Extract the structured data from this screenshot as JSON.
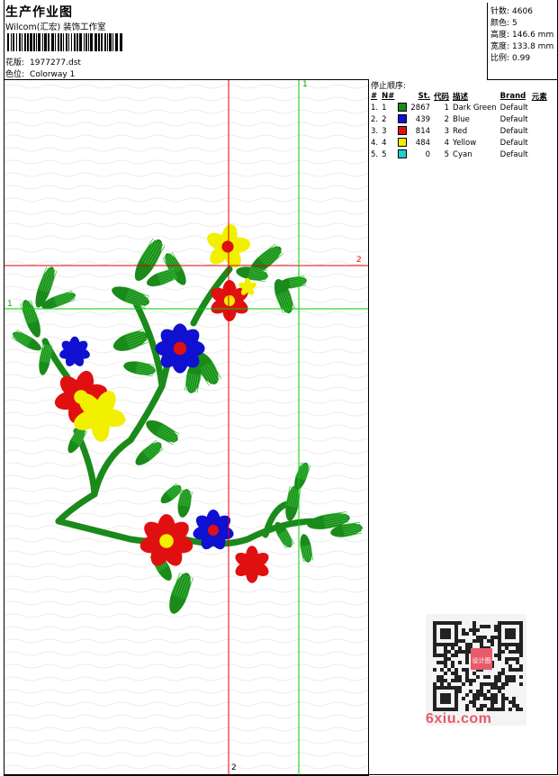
{
  "header": {
    "title": "生产作业图",
    "company": "Wilcom(汇宏) 装饰工作室",
    "design_label": "花版:",
    "design_value": "1977277.dst",
    "colorway_label": "色位:",
    "colorway_value": "Colorway 1"
  },
  "stats": {
    "stitches_label": "针数:",
    "stitches_value": "4606",
    "colors_label": "颜色:",
    "colors_value": "5",
    "height_label": "高度:",
    "height_value": "146.6 mm",
    "width_label": "宽度:",
    "width_value": "133.8 mm",
    "ratio_label": "比例:",
    "ratio_value": "0.99"
  },
  "stop_sequence": {
    "title": "停止顺序:",
    "headers": [
      "#",
      "N#",
      "St.",
      "代码",
      "描述",
      "Brand",
      "元素"
    ],
    "rows": [
      {
        "idx": "1.",
        "n": "1",
        "color": "#1a8a1a",
        "st": "2867",
        "code": "1",
        "desc": "Dark Green",
        "brand": "Default"
      },
      {
        "idx": "2.",
        "n": "2",
        "color": "#1010d0",
        "st": "439",
        "code": "2",
        "desc": "Blue",
        "brand": "Default"
      },
      {
        "idx": "3.",
        "n": "3",
        "color": "#e01010",
        "st": "814",
        "code": "3",
        "desc": "Red",
        "brand": "Default"
      },
      {
        "idx": "4.",
        "n": "4",
        "color": "#f0f000",
        "st": "484",
        "code": "4",
        "desc": "Yellow",
        "brand": "Default"
      },
      {
        "idx": "5.",
        "n": "5",
        "color": "#20d0d0",
        "st": "0",
        "code": "5",
        "desc": "Cyan",
        "brand": "Default"
      }
    ]
  },
  "guides": {
    "red_label_top": "2",
    "red_label_right": "2",
    "green_label_top": "1",
    "green_label_left": "1"
  },
  "watermark": {
    "text": "6xiu.com",
    "seal": "设计图"
  },
  "colors": {
    "dark_green": "#1a8a1a",
    "blue": "#1010d0",
    "red": "#e01010",
    "yellow": "#f0f000",
    "guide_red": "#e00000",
    "guide_green": "#00cc00"
  }
}
